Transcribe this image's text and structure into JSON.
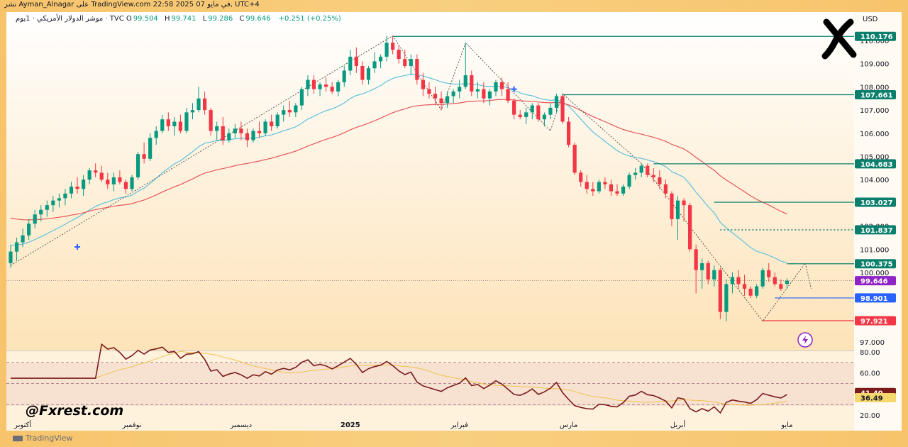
{
  "header": {
    "share_line": "نشر Ayman_Alnagar على TradingView.com 22:58 2025 في مايو 07, UTC+4",
    "symbol": "موشر الدولار الأمريكي · 1يوم · TVC",
    "open_label": "O",
    "open": "99.504",
    "high_label": "H",
    "high": "99.741",
    "low_label": "L",
    "low": "99.286",
    "close_label": "C",
    "close": "99.646",
    "change": "+0.251 (+0.25%)"
  },
  "currency": "USD",
  "watermark": "@Fxrest.com",
  "footer": "TradingView",
  "colors": {
    "up": "#089981",
    "down": "#f23645",
    "ema_fast": "#5fc1dd",
    "ema_slow": "#e8555a",
    "level": "#0a7f6c",
    "rsi": "#7b1a1a",
    "rsi_ma": "#f0c24b",
    "price_tag": "#8e24c5",
    "support_tag": "#2962ff",
    "low_tag": "#f23645"
  },
  "chart_data": [
    {
      "type": "candlestick",
      "title": "",
      "ylim": [
        97.0,
        110.6
      ],
      "y_ticks": [
        "110.000",
        "109.000",
        "108.000",
        "107.000",
        "106.000",
        "105.000",
        "104.000",
        "103.000",
        "102.000",
        "101.000",
        "100.000",
        "99.000",
        "98.000",
        "97.000"
      ],
      "x_labels": [
        "أكتوبر",
        "نوفمبر",
        "ديسمبر",
        "2025",
        "فبراير",
        "مارس",
        "أبريل",
        "مايو"
      ],
      "candles_ohlc": [
        [
          100.4,
          101.2,
          100.2,
          100.9
        ],
        [
          100.9,
          101.5,
          100.5,
          101.3
        ],
        [
          101.3,
          101.9,
          101.1,
          101.6
        ],
        [
          101.6,
          102.3,
          101.4,
          102.1
        ],
        [
          102.1,
          102.7,
          101.9,
          102.5
        ],
        [
          102.5,
          102.9,
          102.2,
          102.7
        ],
        [
          102.7,
          103.1,
          102.4,
          102.9
        ],
        [
          102.9,
          103.3,
          102.6,
          103.1
        ],
        [
          103.1,
          103.4,
          102.8,
          103.2
        ],
        [
          103.2,
          103.6,
          102.9,
          103.4
        ],
        [
          103.4,
          103.9,
          103.2,
          103.7
        ],
        [
          103.7,
          104.1,
          103.4,
          103.6
        ],
        [
          103.6,
          104.2,
          103.3,
          104.0
        ],
        [
          104.0,
          104.5,
          103.8,
          104.4
        ],
        [
          104.4,
          104.7,
          104.1,
          104.3
        ],
        [
          104.3,
          104.6,
          103.9,
          104.0
        ],
        [
          104.0,
          104.3,
          103.6,
          103.8
        ],
        [
          103.8,
          104.3,
          103.5,
          104.1
        ],
        [
          104.1,
          104.4,
          103.8,
          103.9
        ],
        [
          103.9,
          104.0,
          103.4,
          103.6
        ],
        [
          103.6,
          104.2,
          103.5,
          104.1
        ],
        [
          104.1,
          105.2,
          104.0,
          105.1
        ],
        [
          105.1,
          105.6,
          104.7,
          104.9
        ],
        [
          104.9,
          106.0,
          104.8,
          105.8
        ],
        [
          105.8,
          106.3,
          105.5,
          106.1
        ],
        [
          106.1,
          106.8,
          106.0,
          106.6
        ],
        [
          106.6,
          106.9,
          106.1,
          106.3
        ],
        [
          106.3,
          106.7,
          105.9,
          106.5
        ],
        [
          106.5,
          106.8,
          106.0,
          106.1
        ],
        [
          106.1,
          107.1,
          106.0,
          106.9
        ],
        [
          106.9,
          107.3,
          106.6,
          107.0
        ],
        [
          107.0,
          108.0,
          106.9,
          107.5
        ],
        [
          107.5,
          107.8,
          106.8,
          107.0
        ],
        [
          107.0,
          107.1,
          105.9,
          106.1
        ],
        [
          106.1,
          106.5,
          105.7,
          106.3
        ],
        [
          106.3,
          106.7,
          105.5,
          105.7
        ],
        [
          105.7,
          106.2,
          105.6,
          106.0
        ],
        [
          106.0,
          106.4,
          105.8,
          106.2
        ],
        [
          106.2,
          106.5,
          105.7,
          106.0
        ],
        [
          106.0,
          106.2,
          105.4,
          105.7
        ],
        [
          105.7,
          106.2,
          105.6,
          106.1
        ],
        [
          106.1,
          106.5,
          105.8,
          106.0
        ],
        [
          106.0,
          106.6,
          105.9,
          106.5
        ],
        [
          106.5,
          106.8,
          106.1,
          106.3
        ],
        [
          106.3,
          106.9,
          106.2,
          106.8
        ],
        [
          106.8,
          107.2,
          106.5,
          107.0
        ],
        [
          107.0,
          107.4,
          106.7,
          106.9
        ],
        [
          106.9,
          107.3,
          106.7,
          107.2
        ],
        [
          107.2,
          108.0,
          107.0,
          107.9
        ],
        [
          107.9,
          108.5,
          107.6,
          108.3
        ],
        [
          108.3,
          108.5,
          107.7,
          107.9
        ],
        [
          107.9,
          108.2,
          107.6,
          108.1
        ],
        [
          108.1,
          108.4,
          107.8,
          108.0
        ],
        [
          108.0,
          108.2,
          107.7,
          107.8
        ],
        [
          107.8,
          108.3,
          107.6,
          108.2
        ],
        [
          108.2,
          108.9,
          108.0,
          108.7
        ],
        [
          108.7,
          109.6,
          108.5,
          109.3
        ],
        [
          109.3,
          109.7,
          108.6,
          108.9
        ],
        [
          108.9,
          109.1,
          108.1,
          108.3
        ],
        [
          108.3,
          108.9,
          108.1,
          108.8
        ],
        [
          108.8,
          109.5,
          108.6,
          109.1
        ],
        [
          109.1,
          109.4,
          108.8,
          109.3
        ],
        [
          109.3,
          110.2,
          109.1,
          109.9
        ],
        [
          109.9,
          110.2,
          109.4,
          109.6
        ],
        [
          109.6,
          109.8,
          109.0,
          109.2
        ],
        [
          109.2,
          109.6,
          108.8,
          108.9
        ],
        [
          108.9,
          109.4,
          108.5,
          109.2
        ],
        [
          109.2,
          109.4,
          108.1,
          108.3
        ],
        [
          108.3,
          108.6,
          107.6,
          107.9
        ],
        [
          107.9,
          108.2,
          107.5,
          107.7
        ],
        [
          107.7,
          108.0,
          107.2,
          107.5
        ],
        [
          107.5,
          107.8,
          107.0,
          107.3
        ],
        [
          107.3,
          107.8,
          107.1,
          107.6
        ],
        [
          107.6,
          107.9,
          107.3,
          107.8
        ],
        [
          107.8,
          108.3,
          107.5,
          108.0
        ],
        [
          108.0,
          109.9,
          107.9,
          108.5
        ],
        [
          108.5,
          108.7,
          107.6,
          107.8
        ],
        [
          107.8,
          108.2,
          107.5,
          107.9
        ],
        [
          107.9,
          108.2,
          107.3,
          107.5
        ],
        [
          107.5,
          107.9,
          107.2,
          107.8
        ],
        [
          107.8,
          108.3,
          107.6,
          108.2
        ],
        [
          108.2,
          108.4,
          107.6,
          107.9
        ],
        [
          107.9,
          108.2,
          107.3,
          107.4
        ],
        [
          107.4,
          107.5,
          106.6,
          106.8
        ],
        [
          106.8,
          107.0,
          106.6,
          106.7
        ],
        [
          106.7,
          107.1,
          106.4,
          106.9
        ],
        [
          106.9,
          107.3,
          106.6,
          107.2
        ],
        [
          107.2,
          107.3,
          106.5,
          106.6
        ],
        [
          106.6,
          106.9,
          106.3,
          106.8
        ],
        [
          106.8,
          107.3,
          106.6,
          107.1
        ],
        [
          107.1,
          107.7,
          106.9,
          107.6
        ],
        [
          107.6,
          107.7,
          106.4,
          106.5
        ],
        [
          106.5,
          106.7,
          105.4,
          105.5
        ],
        [
          105.5,
          105.6,
          104.2,
          104.3
        ],
        [
          104.3,
          104.4,
          103.7,
          103.9
        ],
        [
          103.9,
          104.2,
          103.4,
          103.6
        ],
        [
          103.6,
          103.9,
          103.3,
          103.5
        ],
        [
          103.5,
          104.0,
          103.4,
          103.9
        ],
        [
          103.9,
          104.1,
          103.6,
          103.8
        ],
        [
          103.8,
          104.0,
          103.3,
          103.5
        ],
        [
          103.5,
          103.8,
          103.3,
          103.4
        ],
        [
          103.4,
          103.8,
          103.3,
          103.7
        ],
        [
          103.7,
          104.3,
          103.6,
          104.2
        ],
        [
          104.2,
          104.5,
          104.0,
          104.3
        ],
        [
          104.3,
          104.7,
          104.1,
          104.6
        ],
        [
          104.6,
          104.7,
          104.1,
          104.2
        ],
        [
          104.2,
          104.5,
          103.9,
          104.1
        ],
        [
          104.1,
          104.4,
          103.6,
          103.8
        ],
        [
          103.8,
          104.0,
          103.2,
          103.4
        ],
        [
          103.4,
          103.5,
          102.0,
          102.3
        ],
        [
          102.3,
          103.3,
          101.4,
          103.1
        ],
        [
          103.1,
          103.2,
          102.2,
          102.9
        ],
        [
          102.9,
          103.0,
          100.9,
          101.0
        ],
        [
          101.0,
          101.2,
          99.1,
          100.1
        ],
        [
          100.1,
          100.6,
          99.3,
          100.4
        ],
        [
          100.4,
          100.5,
          99.5,
          99.7
        ],
        [
          99.7,
          100.3,
          99.4,
          100.1
        ],
        [
          100.1,
          100.2,
          98.0,
          98.3
        ],
        [
          98.3,
          99.7,
          97.9,
          99.5
        ],
        [
          99.5,
          100.0,
          99.1,
          99.8
        ],
        [
          99.8,
          100.1,
          99.3,
          99.5
        ],
        [
          99.5,
          99.9,
          99.0,
          99.3
        ],
        [
          99.3,
          99.4,
          98.9,
          99.0
        ],
        [
          99.0,
          99.5,
          98.9,
          99.4
        ],
        [
          99.4,
          100.2,
          99.3,
          100.1
        ],
        [
          100.1,
          100.4,
          99.6,
          99.8
        ],
        [
          99.8,
          100.0,
          99.4,
          99.5
        ],
        [
          99.5,
          99.7,
          99.2,
          99.3
        ],
        [
          99.504,
          99.741,
          99.286,
          99.646
        ]
      ],
      "levels": [
        {
          "price": "110.176",
          "style": "solid"
        },
        {
          "price": "107.661",
          "style": "solid"
        },
        {
          "price": "104.683",
          "style": "solid"
        },
        {
          "price": "103.027",
          "style": "solid"
        },
        {
          "price": "101.837",
          "style": "dotted"
        },
        {
          "price": "100.375",
          "style": "solid"
        },
        {
          "price": "98.901",
          "style": "solid"
        },
        {
          "price": "97.921",
          "style": "solid"
        }
      ],
      "current_price": "99.646"
    },
    {
      "type": "line",
      "title": "",
      "ylim": [
        20,
        80
      ],
      "y_ticks": [
        "80.00",
        "60.00",
        "40.00",
        "20.00"
      ],
      "rsi_value": "41.40",
      "rsi_ma_value": "36.49"
    }
  ]
}
